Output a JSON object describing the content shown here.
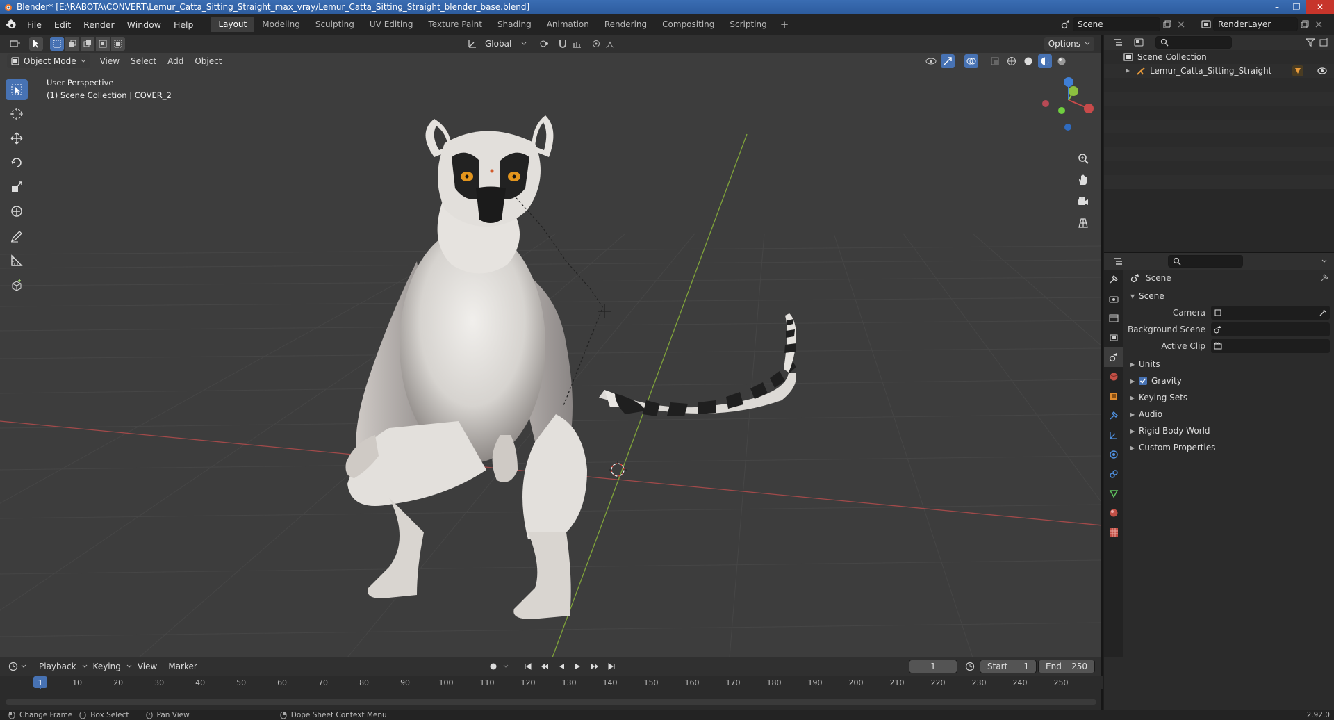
{
  "window": {
    "title": "Blender* [E:\\RABOTA\\CONVERT\\Lemur_Catta_Sitting_Straight_max_vray/Lemur_Catta_Sitting_Straight_blender_base.blend]",
    "minimize": "–",
    "maximize": "❐",
    "close": "✕"
  },
  "menu": [
    "File",
    "Edit",
    "Render",
    "Window",
    "Help"
  ],
  "workspace_tabs": [
    {
      "label": "Layout",
      "active": true
    },
    {
      "label": "Modeling"
    },
    {
      "label": "Sculpting"
    },
    {
      "label": "UV Editing"
    },
    {
      "label": "Texture Paint"
    },
    {
      "label": "Shading"
    },
    {
      "label": "Animation"
    },
    {
      "label": "Rendering"
    },
    {
      "label": "Compositing"
    },
    {
      "label": "Scripting"
    }
  ],
  "workspace_add": "+",
  "scene_field": "Scene",
  "renderlayer_field": "RenderLayer",
  "viewport": {
    "transform_orientation": "Global",
    "options_label": "Options",
    "mode_label": "Object Mode",
    "header_menu": [
      "View",
      "Select",
      "Add",
      "Object"
    ],
    "overlay_line1": "User Perspective",
    "overlay_line2": "(1) Scene Collection | COVER_2",
    "gizmo_axes": {
      "x": "X",
      "y": "Y",
      "z": "Z"
    }
  },
  "outliner": {
    "root": "Scene Collection",
    "items": [
      {
        "label": "Lemur_Catta_Sitting_Straight"
      }
    ]
  },
  "properties": {
    "header": "Scene",
    "panel": "Scene",
    "fields": [
      {
        "label": "Camera"
      },
      {
        "label": "Background Scene"
      },
      {
        "label": "Active Clip"
      }
    ],
    "sections": [
      {
        "label": "Units",
        "checkbox": false
      },
      {
        "label": "Gravity",
        "checkbox": true
      },
      {
        "label": "Keying Sets",
        "checkbox": false
      },
      {
        "label": "Audio",
        "checkbox": false
      },
      {
        "label": "Rigid Body World",
        "checkbox": false
      },
      {
        "label": "Custom Properties",
        "checkbox": false
      }
    ]
  },
  "timeline": {
    "menu": [
      "Playback",
      "Keying",
      "View",
      "Marker"
    ],
    "current_frame": "1",
    "start_label": "Start",
    "start_value": "1",
    "end_label": "End",
    "end_value": "250",
    "ruler_labels": [
      "1",
      "10",
      "20",
      "30",
      "40",
      "50",
      "60",
      "70",
      "80",
      "90",
      "100",
      "110",
      "120",
      "130",
      "140",
      "150",
      "160",
      "170",
      "180",
      "190",
      "200",
      "210",
      "220",
      "230",
      "240",
      "250"
    ]
  },
  "statusbar": {
    "items": [
      "Change Frame",
      "Box Select",
      "Pan View",
      "Dope Sheet Context Menu"
    ],
    "version": "2.92.0"
  },
  "colors": {
    "accent": "#4772b3",
    "x_axis": "#c84a4a",
    "y_axis": "#8cbf3f",
    "z_axis": "#3f7fd6"
  }
}
